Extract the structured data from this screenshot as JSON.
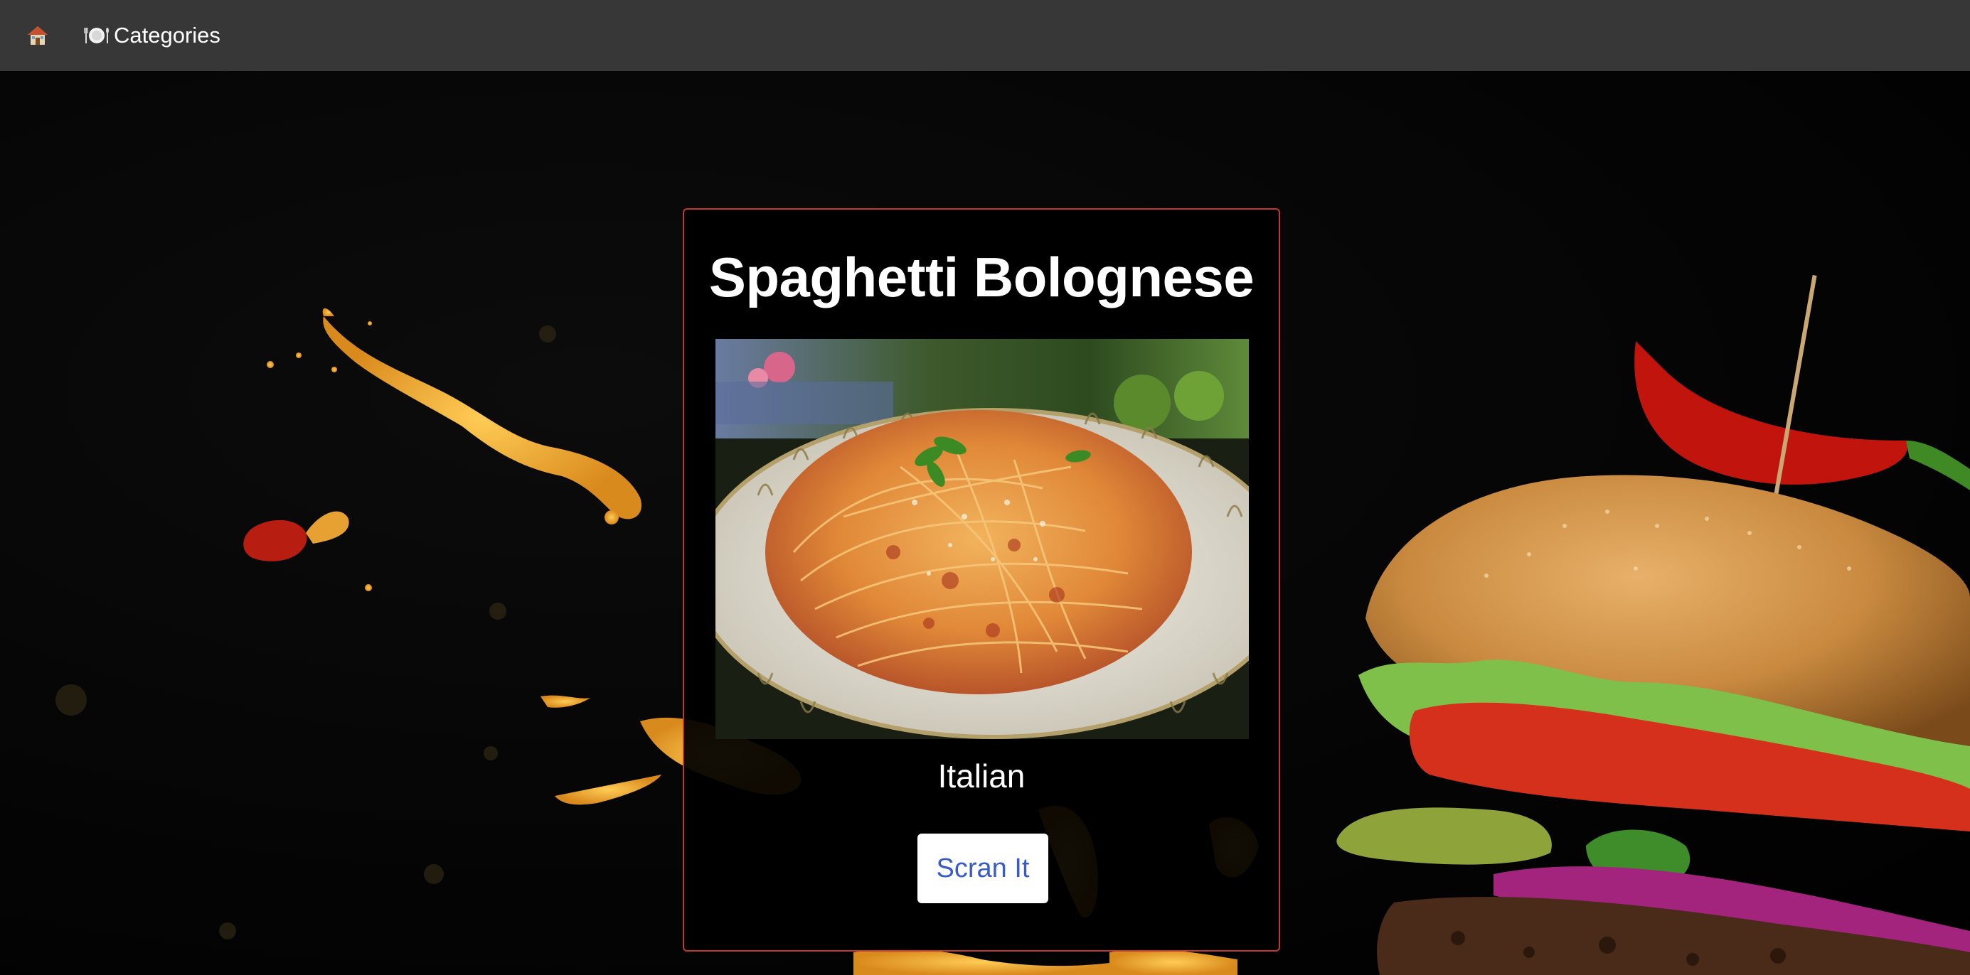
{
  "nav": {
    "home_icon": "house-icon",
    "categories_icon": "plate-icon",
    "categories_label": "Categories"
  },
  "recipe": {
    "title": "Spaghetti Bolognese",
    "photo_subject": "spaghetti-plate",
    "category": "Italian",
    "action_label": "Scran It"
  },
  "colors": {
    "navbar": "#373737",
    "card_border": "#c2392f",
    "button_text": "#3b5bc4",
    "background": "#000000"
  }
}
